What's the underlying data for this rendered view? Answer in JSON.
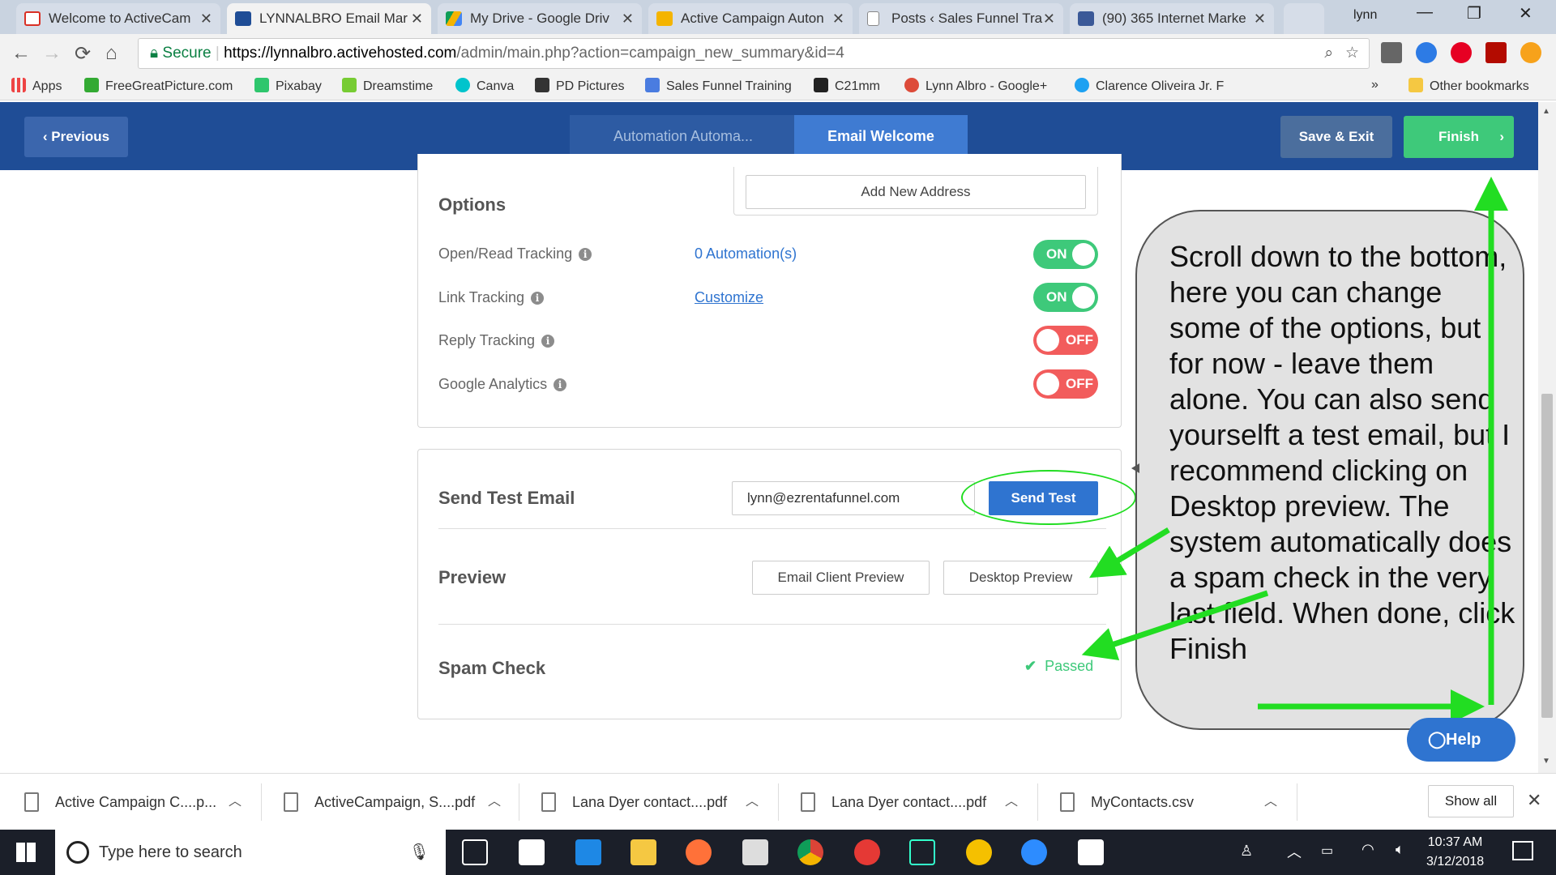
{
  "browser": {
    "tabs": [
      {
        "title": "Welcome to ActiveCam",
        "icon": "gmail-icon",
        "color": "#d93025"
      },
      {
        "title": "LYNNALBRO Email Mar",
        "icon": "activecampaign-icon",
        "color": "#1f4d96"
      },
      {
        "title": "My Drive - Google Driv",
        "icon": "google-drive-icon",
        "color": "#f4b400"
      },
      {
        "title": "Active Campaign Auton",
        "icon": "google-slides-icon",
        "color": "#f4b400"
      },
      {
        "title": "Posts ‹ Sales Funnel Tra",
        "icon": "page-icon",
        "color": "#888888"
      },
      {
        "title": "(90) 365 Internet Marke",
        "icon": "facebook-icon",
        "color": "#3b5998"
      }
    ],
    "profile": "lynn",
    "url": {
      "secure": "Secure",
      "host": "https://lynnalbro.activehosted.com",
      "path": "/admin/main.php?action=campaign_new_summary&id=4"
    },
    "bookmarks": [
      "Apps",
      "FreeGreatPicture.com",
      "Pixabay",
      "Dreamstime",
      "Canva",
      "PD Pictures",
      "Sales Funnel Training",
      "C21mm",
      "Lynn Albro - Google+",
      "Clarence Oliveira Jr. F"
    ],
    "other_bookmarks": "Other bookmarks",
    "more": "»"
  },
  "header": {
    "previous": "‹  Previous",
    "steps": [
      "Automation Automa...",
      "Email Welcome"
    ],
    "save_exit": "Save & Exit",
    "finish": "Finish",
    "finish_chevron": "›",
    "brand_color": "#1f4d96"
  },
  "options": {
    "add_address": "Add New Address",
    "title": "Options",
    "rows": [
      {
        "label": "Open/Read Tracking",
        "value": "0 Automation(s)",
        "toggle": "ON"
      },
      {
        "label": "Link Tracking",
        "value": "Customize",
        "toggle": "ON"
      },
      {
        "label": "Reply Tracking",
        "value": "",
        "toggle": "OFF"
      },
      {
        "label": "Google Analytics",
        "value": "",
        "toggle": "OFF"
      }
    ]
  },
  "test": {
    "title": "Send Test Email",
    "email": "lynn@ezrentafunnel.com",
    "send": "Send Test",
    "preview_title": "Preview",
    "email_client_preview": "Email Client Preview",
    "desktop_preview": "Desktop Preview",
    "spam_title": "Spam Check",
    "spam_status": "Passed"
  },
  "annotation": {
    "text": "Scroll down to the bottom, here you can change some of the options, but for now - leave them alone. You can also send yourselft a test email, but I recommend clicking on Desktop preview. The system automatically does a spam check in the very last field. When done, click Finish",
    "arrow_color": "#22dd22"
  },
  "help": "Help",
  "downloads": {
    "items": [
      "Active Campaign C....p...",
      "ActiveCampaign, S....pdf",
      "Lana Dyer contact....pdf",
      "Lana Dyer contact....pdf",
      "MyContacts.csv"
    ],
    "show_all": "Show all"
  },
  "taskbar": {
    "search_placeholder": "Type here to search",
    "time": "10:37 AM",
    "date": "3/12/2018"
  }
}
